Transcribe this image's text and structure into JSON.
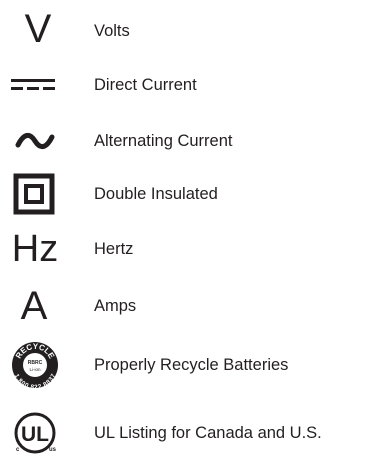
{
  "symbols": [
    {
      "glyph": "V",
      "icon": "volts-symbol-icon",
      "label": "Volts"
    },
    {
      "glyph": "",
      "icon": "direct-current-symbol-icon",
      "label": "Direct Current"
    },
    {
      "glyph": "~",
      "icon": "alternating-current-symbol-icon",
      "label": "Alternating Current"
    },
    {
      "glyph": "",
      "icon": "double-insulated-symbol-icon",
      "label": "Double Insulated"
    },
    {
      "glyph": "Hz",
      "icon": "hertz-symbol-icon",
      "label": "Hertz"
    },
    {
      "glyph": "A",
      "icon": "amps-symbol-icon",
      "label": "Amps"
    },
    {
      "glyph": "",
      "icon": "rbrc-recycle-seal-icon",
      "label": "Properly Recycle Batteries",
      "seal_text": {
        "top": "RECYCLE",
        "middle": "RBRC",
        "bottom": "Li-ion",
        "phone": "1.800.822.8837"
      }
    },
    {
      "glyph": "UL",
      "icon": "ul-listing-mark-icon",
      "label": "UL Listing for Canada and U.S."
    }
  ]
}
